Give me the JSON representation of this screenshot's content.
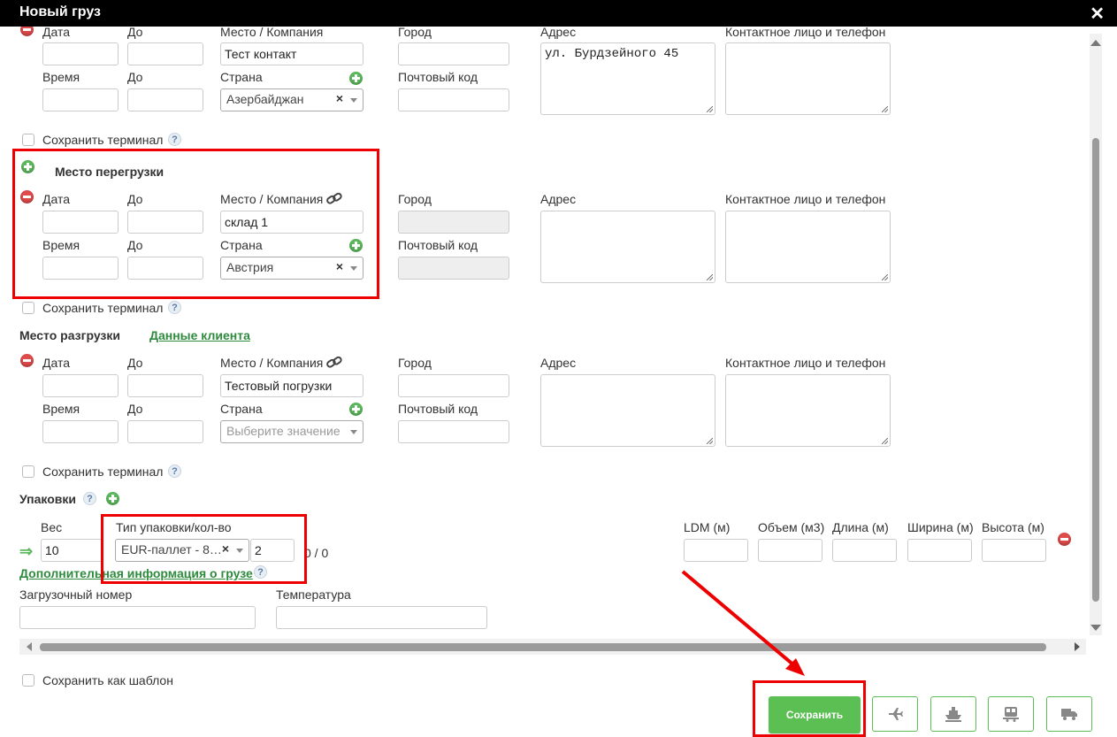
{
  "window": {
    "title": "Новый груз",
    "close_glyph": "✕"
  },
  "section_top": {
    "labels": {
      "date": "Дата",
      "to": "До",
      "place": "Место / Компания",
      "city": "Город",
      "address": "Адрес",
      "contact": "Контактное лицо и телефон",
      "time": "Время",
      "to2": "До",
      "country": "Страна",
      "postal": "Почтовый код"
    },
    "place_value": "Тест контакт",
    "country_value": "Азербайджан",
    "address_value": "ул. Бурдзейного 45",
    "save_terminal": "Сохранить терминал"
  },
  "transshipment": {
    "heading": "Место перегрузки",
    "labels": {
      "date": "Дата",
      "to": "До",
      "place": "Место / Компания",
      "city": "Город",
      "address": "Адрес",
      "contact": "Контактное лицо и телефон",
      "time": "Время",
      "to2": "До",
      "country": "Страна",
      "postal": "Почтовый код"
    },
    "place_value": "склад 1",
    "country_value": "Австрия",
    "save_terminal": "Сохранить терминал"
  },
  "unloading": {
    "heading": "Место разгрузки",
    "client_data_link": "Данные клиента",
    "labels": {
      "date": "Дата",
      "to": "До",
      "place": "Место / Компания",
      "city": "Город",
      "address": "Адрес",
      "contact": "Контактное лицо и телефон",
      "time": "Время",
      "to2": "До",
      "country": "Страна",
      "postal": "Почтовый код"
    },
    "place_value": "Тестовый погрузки",
    "country_placeholder": "Выберите значение",
    "save_terminal": "Сохранить терминал"
  },
  "packages": {
    "heading": "Упаковки",
    "weight_label": "Вес",
    "weight_value": "10",
    "type_label": "Тип упаковки/кол-во",
    "type_value": "EUR-паллет - 8…",
    "qty_value": "2",
    "ratio": "0 / 0",
    "ldm_label": "LDM (м)",
    "volume_label": "Объем (м3)",
    "length_label": "Длина (м)",
    "width_label": "Ширина (м)",
    "height_label": "Высота (м)",
    "extra_info_link": "Дополнительная информация о грузе",
    "loading_number_label": "Загрузочный номер",
    "temperature_label": "Температура"
  },
  "footer": {
    "save_template": "Сохранить как шаблон",
    "save_button": "Сохранить",
    "icons": [
      "plane-icon",
      "ship-icon",
      "train-icon",
      "truck-icon"
    ]
  },
  "colors": {
    "accent_green": "#5cbf53",
    "highlight_red": "#e00000"
  }
}
